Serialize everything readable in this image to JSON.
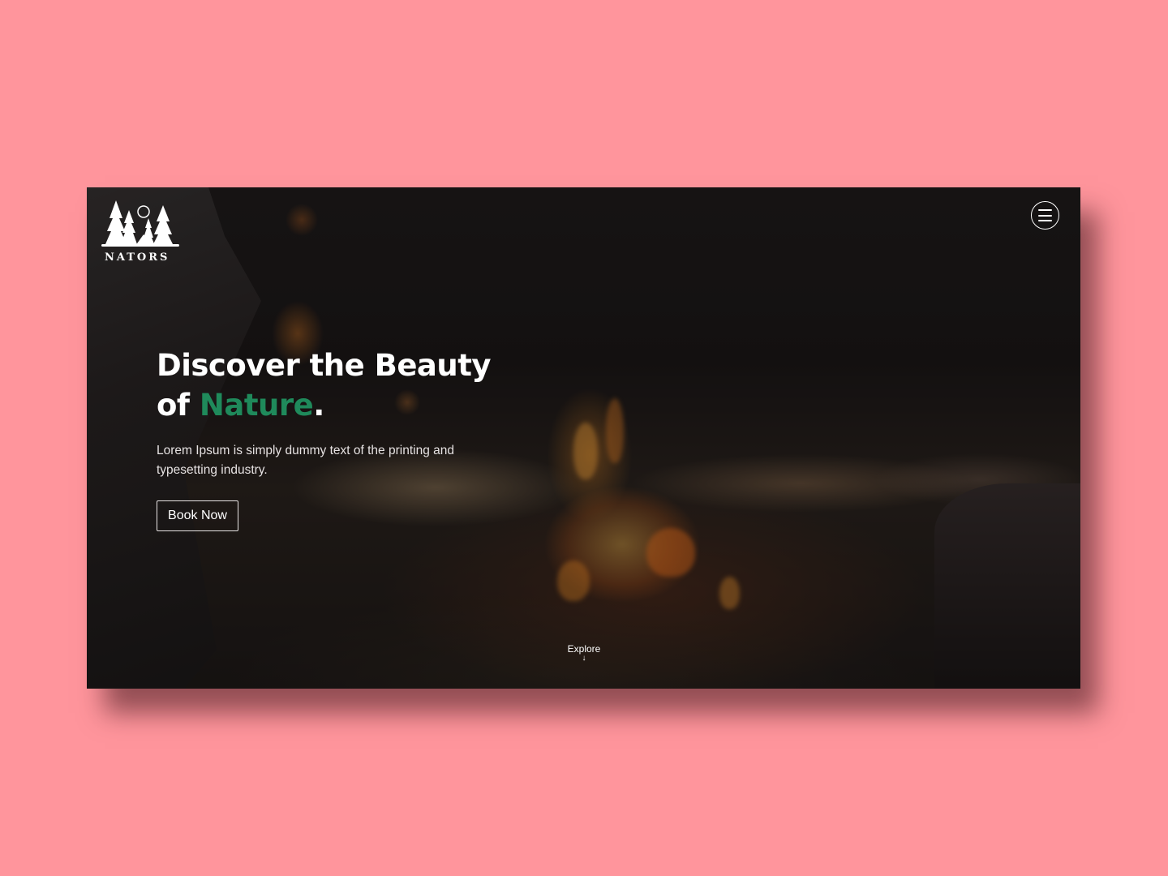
{
  "logo": {
    "text": "NATORS"
  },
  "nav": {
    "menu_icon": "hamburger-menu-icon"
  },
  "hero": {
    "title_line1": "Discover the Beauty",
    "title_of": "of ",
    "title_accent": "Nature",
    "title_period": ".",
    "description": "Lorem Ipsum is simply dummy text of the printing and typesetting industry.",
    "cta_label": "Book Now"
  },
  "explore": {
    "label": "Explore",
    "arrow": "↓"
  },
  "colors": {
    "page_background": "#ff959c",
    "accent": "#1f8a5b",
    "text": "#ffffff"
  }
}
